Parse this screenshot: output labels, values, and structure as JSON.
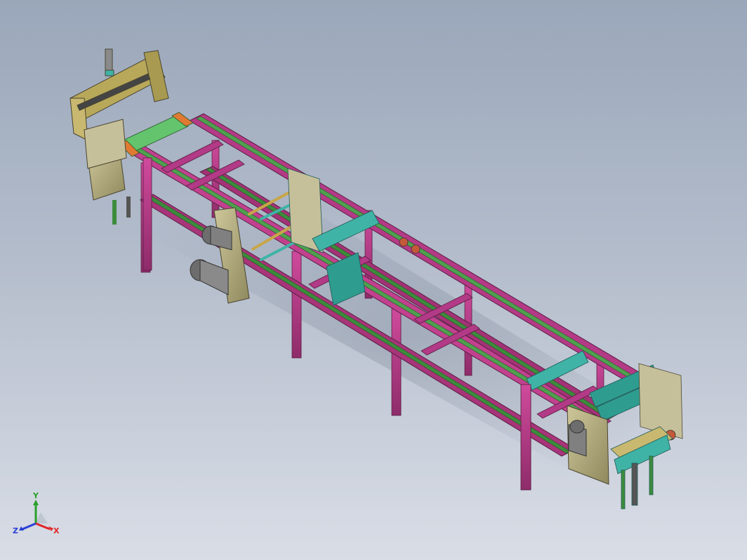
{
  "viewport": {
    "background_top": "#9aa7ba",
    "background_bottom": "#d9dde6"
  },
  "model": {
    "description_colors": {
      "frame": "#b23a86",
      "rail": "#3c8c3c",
      "panel": "#b8b183",
      "fixture": "#3fb3a6",
      "motor": "#7d7d7d",
      "shaft": "#c8a648",
      "conveyor_belt": "#63c46d"
    }
  },
  "triad": {
    "x_label": "X",
    "y_label": "Y",
    "z_label": "Z",
    "x_color": "#e02828",
    "y_color": "#2aa02a",
    "z_color": "#2a3fd6"
  }
}
